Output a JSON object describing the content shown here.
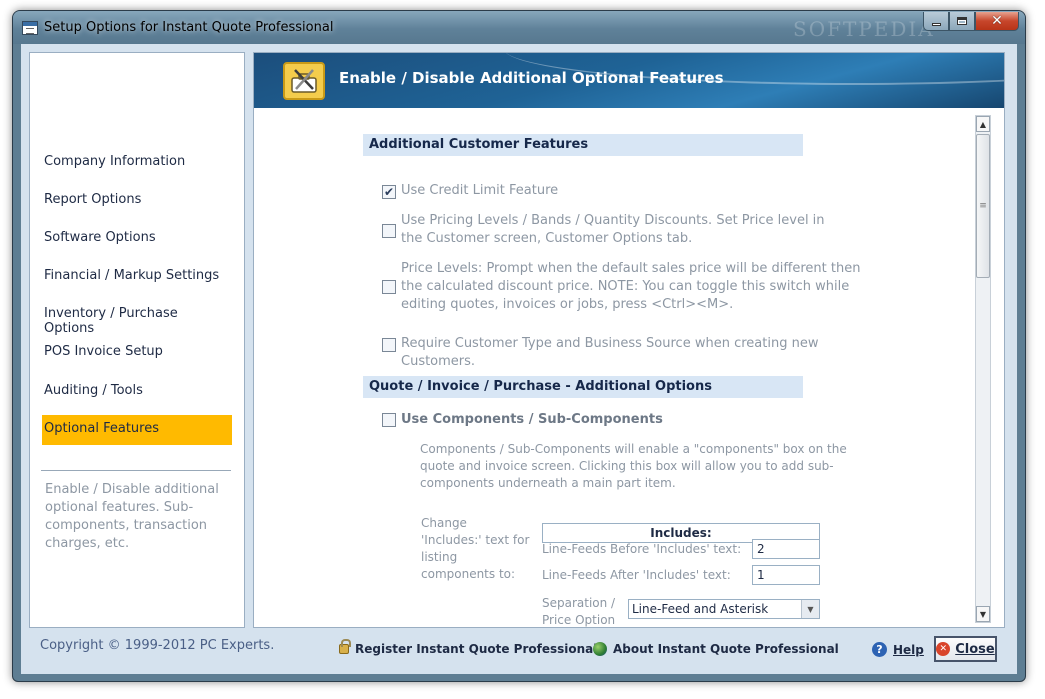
{
  "window": {
    "title": "Setup Options for Instant Quote Professional",
    "watermark": "SOFTPEDIA"
  },
  "sidebar": {
    "items": [
      {
        "label": "Company Information"
      },
      {
        "label": "Report Options"
      },
      {
        "label": "Software Options"
      },
      {
        "label": "Financial / Markup Settings"
      },
      {
        "label": "Inventory / Purchase Options"
      },
      {
        "label": "POS Invoice Setup"
      },
      {
        "label": "Auditing / Tools"
      },
      {
        "label": "Optional Features"
      }
    ],
    "active_index": 7,
    "active_color": "#ffba00",
    "description": "Enable / Disable additional optional features. Sub-components, transaction charges, etc."
  },
  "header": {
    "title": "Enable / Disable Additional Optional Features",
    "icon": "tools-icon"
  },
  "sections": {
    "customer": {
      "title": "Additional Customer Features",
      "options": [
        {
          "label": "Use Credit Limit Feature",
          "checked": true
        },
        {
          "label": "Use Pricing Levels / Bands / Quantity Discounts. Set Price level in the Customer screen, Customer Options tab.",
          "checked": false
        },
        {
          "label": "Price Levels: Prompt when the default sales price will be different then the calculated discount price. NOTE:  You can toggle this switch while editing quotes, invoices or jobs, press <Ctrl><M>.",
          "checked": false
        },
        {
          "label": "Require Customer Type and Business Source when creating new Customers.",
          "checked": false
        }
      ]
    },
    "quote": {
      "title": "Quote / Invoice / Purchase - Additional Options",
      "components_option": {
        "label": "Use Components / Sub-Components",
        "checked": false
      },
      "components_info": "Components / Sub-Components will enable a \"components\" box on the quote and invoice screen. Clicking this box will allow you to add sub-components underneath a main part item.",
      "change_includes_label": "Change 'Includes:' text for listing components to:",
      "includes_value": "Includes:",
      "linefeeds_before_label": "Line-Feeds Before 'Includes' text:",
      "linefeeds_before_value": "2",
      "linefeeds_after_label": "Line-Feeds After 'Includes' text:",
      "linefeeds_after_value": "1",
      "separation_label": "Separation / Price Option",
      "separation_value": "Line-Feed and Asterisk"
    }
  },
  "footer": {
    "copyright": "Copyright © 1999-2012 PC Experts.",
    "register_label": "Register Instant Quote Professional",
    "about_label": "About Instant Quote Professional",
    "help_label": "Help",
    "close_label": "Close"
  }
}
